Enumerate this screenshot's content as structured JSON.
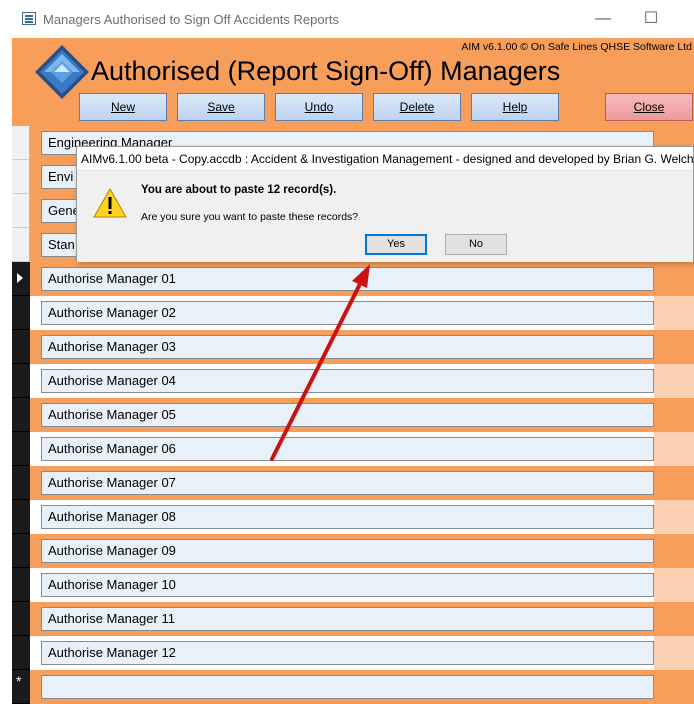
{
  "window": {
    "title": "Managers Authorised to Sign Off Accidents Reports",
    "minimize_glyph": "—",
    "maximize_glyph": "☐"
  },
  "header": {
    "credit": "AIM v6.1.00 © On Safe Lines QHSE Software Ltd",
    "title": "Authorised (Report Sign-Off) Managers"
  },
  "toolbar": {
    "new_label": "New",
    "save_label": "Save",
    "undo_label": "Undo",
    "delete_label": "Delete",
    "help_label": "Help",
    "close_label": "Close"
  },
  "records": [
    "Engineering Manager",
    "Envi",
    "Gene",
    "Stan",
    "Authorise Manager 01",
    "Authorise Manager 02",
    "Authorise Manager 03",
    "Authorise Manager 04",
    "Authorise Manager 05",
    "Authorise Manager 06",
    "Authorise Manager 07",
    "Authorise Manager 08",
    "Authorise Manager 09",
    "Authorise Manager 10",
    "Authorise Manager 11",
    "Authorise Manager 12",
    ""
  ],
  "new_record_marker": "*",
  "dialog": {
    "title": "AIMv6.1.00 beta - Copy.accdb : Accident & Investigation Management - designed and developed by Brian G. Welch",
    "message": "You are about to paste 12 record(s).",
    "question": "Are you sure you want to paste these records?",
    "yes_label": "Yes",
    "no_label": "No",
    "icon": "warning-icon"
  },
  "colors": {
    "header_orange": "#f79e5a",
    "field_fill": "#e8f0fa",
    "close_button": "#ee9a9a",
    "annotation_arrow": "#cc1111"
  }
}
